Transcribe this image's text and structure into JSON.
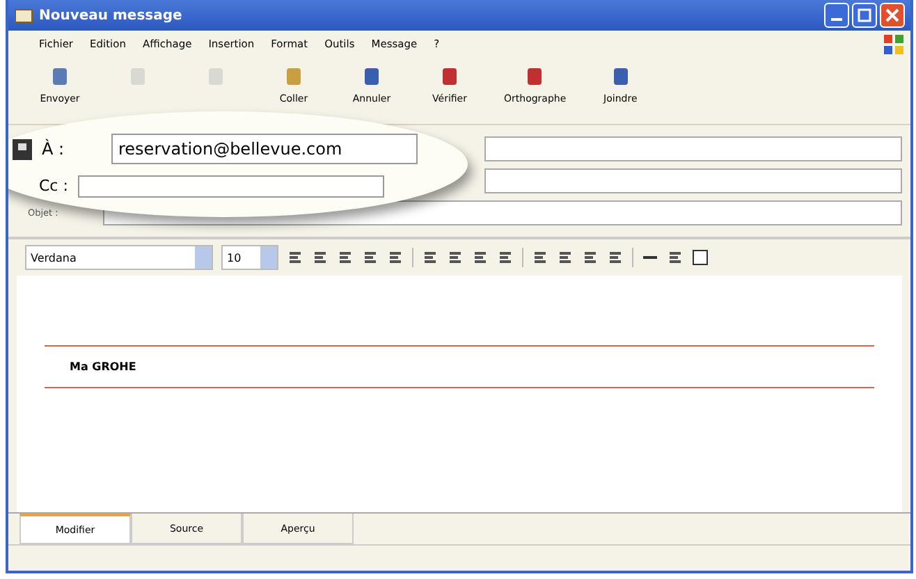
{
  "window": {
    "title": "Nouveau message"
  },
  "menu": [
    "Fichier",
    "Edition",
    "Affichage",
    "Insertion",
    "Format",
    "Outils",
    "Message",
    "?"
  ],
  "toolbar": [
    {
      "kind": "send",
      "label": "Envoyer",
      "disabled": false
    },
    {
      "kind": "cut",
      "disabled": true
    },
    {
      "kind": "copy",
      "disabled": true
    },
    {
      "kind": "paste",
      "label": "Coller",
      "disabled": false
    },
    {
      "kind": "undo",
      "label": "Annuler",
      "disabled": false
    },
    {
      "kind": "check",
      "label": "Vérifier",
      "disabled": false
    },
    {
      "kind": "spell",
      "label": "Orthographe",
      "disabled": false
    },
    {
      "kind": "attach",
      "label": "Joindre",
      "disabled": false
    }
  ],
  "header": {
    "to": {
      "label": "À :",
      "value": "reservation@bellevue.com"
    },
    "cc": {
      "label": "Cc :"
    },
    "subject": {
      "label": "Objet :"
    }
  },
  "format": {
    "font": "Verdana",
    "size": "10"
  },
  "body": {
    "signature": "Ma GROHE"
  },
  "tabs": [
    {
      "label": "Modifier",
      "selected": true
    },
    {
      "label": "Source",
      "selected": false
    },
    {
      "label": "Aperçu",
      "selected": false
    }
  ]
}
